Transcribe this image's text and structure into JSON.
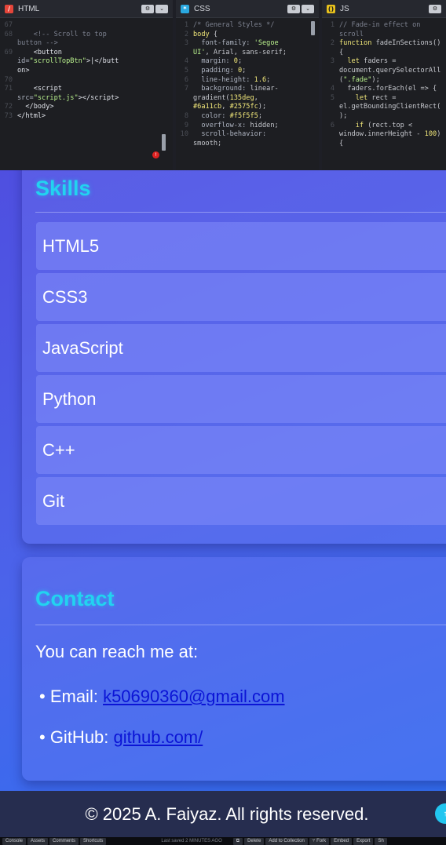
{
  "editors": {
    "html": {
      "label": "HTML",
      "lines": [
        {
          "n": "67",
          "html": ""
        },
        {
          "n": "68",
          "html": "<span class='c-com'>    &lt;!-- Scroll to top</span>"
        },
        {
          "n": "",
          "html": "<span class='c-com'>button --&gt;</span>"
        },
        {
          "n": "69",
          "html": "<span class='c-tag'>    &lt;button</span>"
        },
        {
          "n": "",
          "html": "<span class='c-prop'>id=</span><span class='c-str'>\"scrollTopBtn\"</span><span class='c-tag'>&gt;|&lt;/butt</span>"
        },
        {
          "n": "",
          "html": "<span class='c-tag'>on&gt;</span>"
        },
        {
          "n": "70",
          "html": ""
        },
        {
          "n": "71",
          "html": "<span class='c-tag'>    &lt;script</span>"
        },
        {
          "n": "",
          "html": "<span class='c-prop'>src=</span><span class='c-str'>\"script.js\"</span><span class='c-tag'>&gt;&lt;/script&gt;</span>"
        },
        {
          "n": "72",
          "html": "<span class='c-tag'>  &lt;/body&gt;</span>"
        },
        {
          "n": "73",
          "html": "<span class='c-tag'>&lt;/html&gt;</span>"
        }
      ]
    },
    "css": {
      "label": "CSS",
      "lines": [
        {
          "n": "1",
          "html": "<span class='c-com'>/* General Styles */</span>"
        },
        {
          "n": "2",
          "html": "<span class='c-kw'>body</span> {"
        },
        {
          "n": "3",
          "html": "  <span class='c-prop'>font-family:</span> <span class='c-str'>'Segoe</span>"
        },
        {
          "n": "",
          "html": "<span class='c-str'>UI'</span>, Arial, sans-serif;"
        },
        {
          "n": "4",
          "html": "  <span class='c-prop'>margin:</span> <span class='c-kw'>0</span>;"
        },
        {
          "n": "5",
          "html": "  <span class='c-prop'>padding:</span> <span class='c-kw'>0</span>;"
        },
        {
          "n": "6",
          "html": "  <span class='c-prop'>line-height:</span> <span class='c-kw'>1.6</span>;"
        },
        {
          "n": "7",
          "html": "  <span class='c-prop'>background:</span> linear-"
        },
        {
          "n": "",
          "html": "gradient(<span class='c-kw'>135deg</span>,"
        },
        {
          "n": "",
          "html": "<span class='c-kw'>#6a11cb</span>, <span class='c-kw'>#2575fc</span>);"
        },
        {
          "n": "8",
          "html": "  <span class='c-prop'>color:</span> <span class='c-kw'>#f5f5f5</span>;"
        },
        {
          "n": "9",
          "html": "  <span class='c-prop'>overflow-x:</span> hidden;"
        },
        {
          "n": "10",
          "html": "  <span class='c-prop'>scroll-behavior:</span>"
        },
        {
          "n": "",
          "html": "smooth;"
        }
      ]
    },
    "js": {
      "label": "JS",
      "lines": [
        {
          "n": "1",
          "html": "<span class='c-com'>// Fade-in effect on</span>"
        },
        {
          "n": "",
          "html": "<span class='c-com'>scroll</span>"
        },
        {
          "n": "2",
          "html": "<span class='c-kw'>function</span> fadeInSections()"
        },
        {
          "n": "",
          "html": "{"
        },
        {
          "n": "3",
          "html": "  <span class='c-kw'>let</span> faders ="
        },
        {
          "n": "",
          "html": "document.querySelectorAll"
        },
        {
          "n": "",
          "html": "(<span class='c-str'>\".fade\"</span>);"
        },
        {
          "n": "4",
          "html": "  faders.forEach(el =&gt; {"
        },
        {
          "n": "5",
          "html": "    <span class='c-kw'>let</span> rect ="
        },
        {
          "n": "",
          "html": "el.getBoundingClientRect("
        },
        {
          "n": "",
          "html": ");"
        },
        {
          "n": "6",
          "html": "    <span class='c-kw'>if</span> (rect.top &lt;"
        },
        {
          "n": "",
          "html": "window.innerHeight - <span class='c-kw'>100</span>)"
        },
        {
          "n": "",
          "html": "{"
        }
      ]
    }
  },
  "preview": {
    "skills_title": "Skills",
    "skills": [
      "HTML5",
      "CSS3",
      "JavaScript",
      "Python",
      "C++",
      "Git"
    ],
    "contact_title": "Contact",
    "contact_intro": "You can reach me at:",
    "email_label": "• Email: ",
    "email_value": "k50690360@gmail.com",
    "github_label": "• GitHub: ",
    "github_value": "github.com/",
    "footer": "© 2025 A. Faiyaz. All rights reserved.",
    "scroll_top_glyph": "↑"
  },
  "statusbar": {
    "console": "Console",
    "assets": "Assets",
    "comments": "Comments",
    "shortcuts": "Shortcuts",
    "saved": "Last saved 2 MINUTES AGO",
    "delete": "Delete",
    "add_collection": "Add to Collection",
    "fork": "Fork",
    "embed": "Embed",
    "export": "Export",
    "share": "Sh"
  },
  "colors": {
    "accent_title": "#22d3f0",
    "link": "#0b14d6",
    "footer_bg": "#262d4f"
  }
}
